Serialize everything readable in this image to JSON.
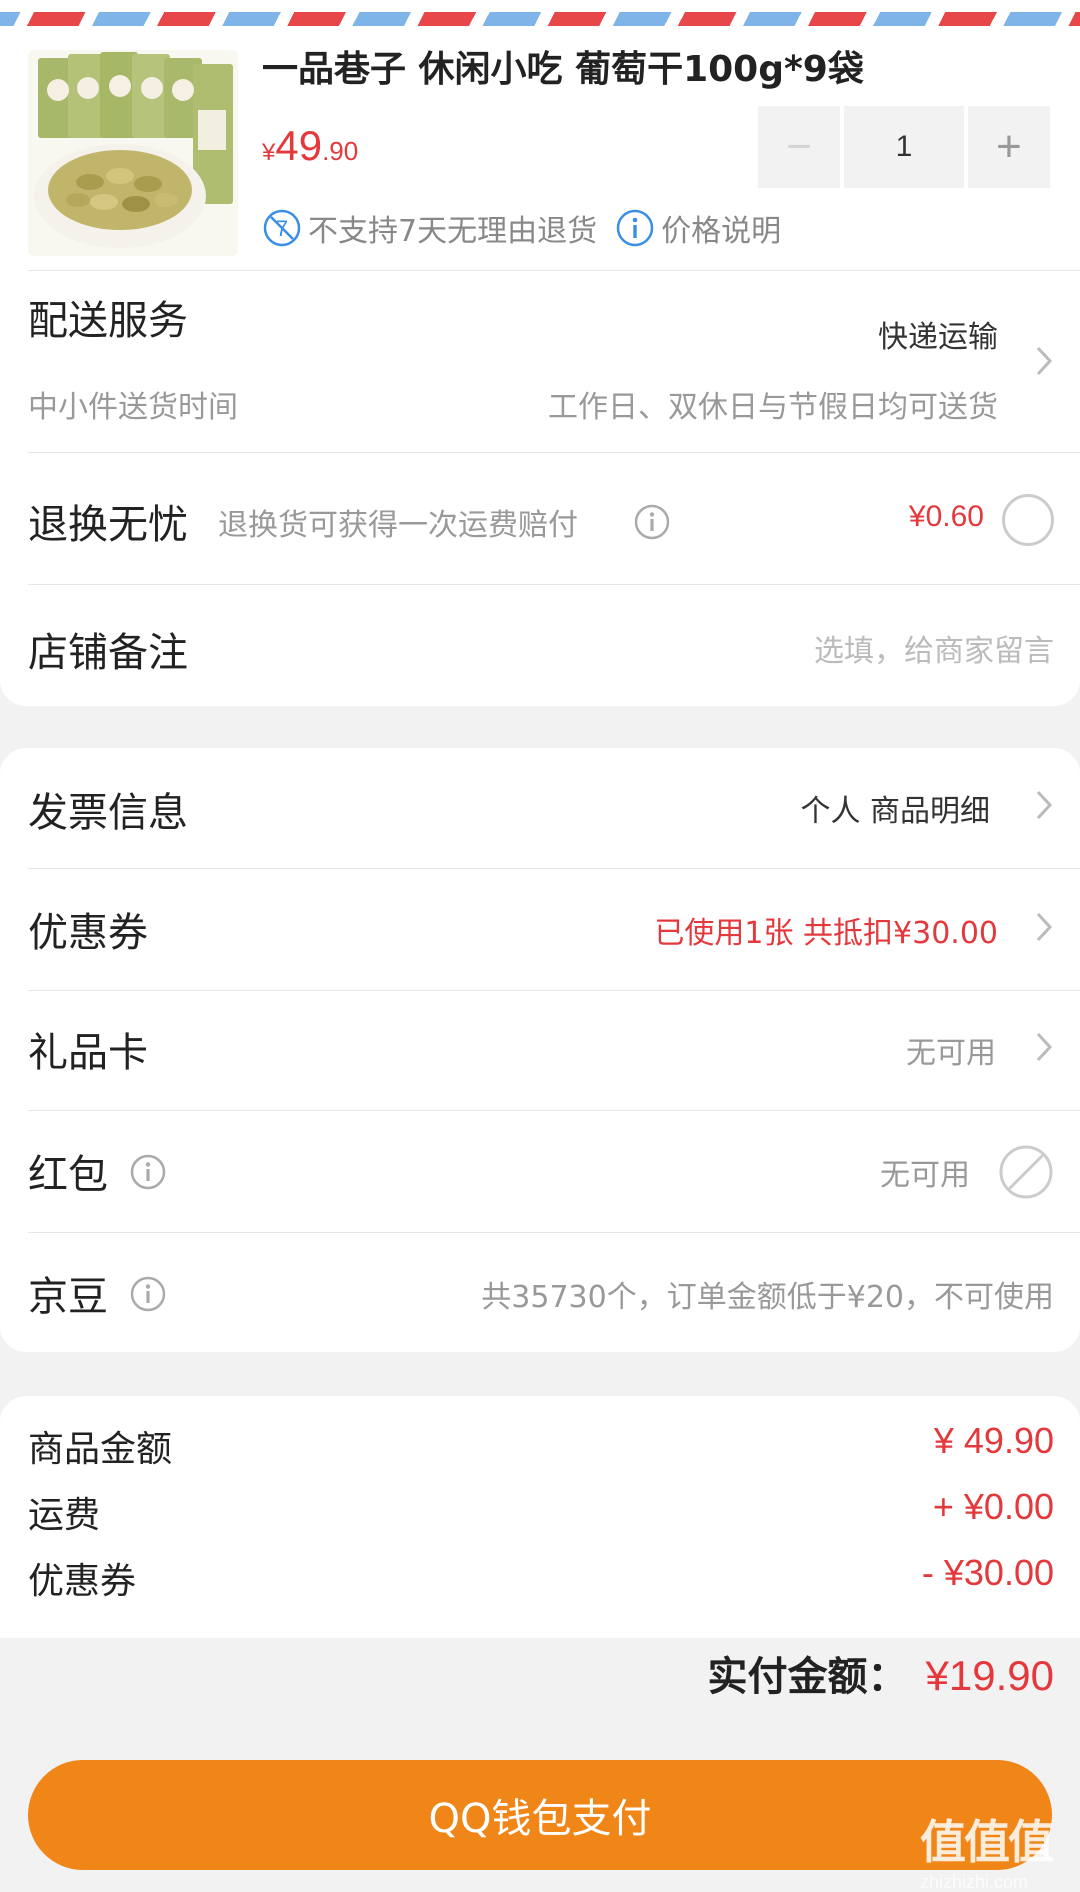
{
  "product": {
    "title": "一品巷子 休闲小吃 葡萄干100g*9袋",
    "price_currency": "¥",
    "price_int": "49",
    "price_dec": ".90",
    "quantity": "1",
    "minus_symbol": "−",
    "plus_symbol": "+",
    "notice_no_return": "不支持7天无理由退货",
    "notice_price": "价格说明"
  },
  "delivery": {
    "label": "配送服务",
    "method": "快递运输",
    "sublabel": "中小件送货时间",
    "time": "工作日、双休日与节假日均可送货"
  },
  "return_insurance": {
    "label": "退换无忧",
    "desc": "退换货可获得一次运费赔付",
    "price": "¥0.60"
  },
  "shop_note": {
    "label": "店铺备注",
    "placeholder": "选填，给商家留言"
  },
  "invoice": {
    "label": "发票信息",
    "value": "个人 商品明细"
  },
  "coupon": {
    "label": "优惠券",
    "value": "已使用1张 共抵扣¥30.00"
  },
  "gift_card": {
    "label": "礼品卡",
    "value": "无可用"
  },
  "red_packet": {
    "label": "红包",
    "value": "无可用"
  },
  "jingdou": {
    "label": "京豆",
    "value": "共35730个，订单金额低于¥20，不可使用"
  },
  "summary": {
    "items": [
      {
        "label": "商品金额",
        "value": "¥ 49.90"
      },
      {
        "label": "运费",
        "value": "+ ¥0.00"
      },
      {
        "label": "优惠券",
        "value": "- ¥30.00"
      }
    ],
    "total_label": "实付金额：",
    "total_value": "¥19.90"
  },
  "pay_button": "QQ钱包支付",
  "watermark": {
    "big": "值值值",
    "small": "zhizhizhi.com"
  },
  "colors": {
    "accent_red": "#e4393c",
    "pay_orange": "#f08518",
    "info_blue": "#3a8ee6"
  }
}
